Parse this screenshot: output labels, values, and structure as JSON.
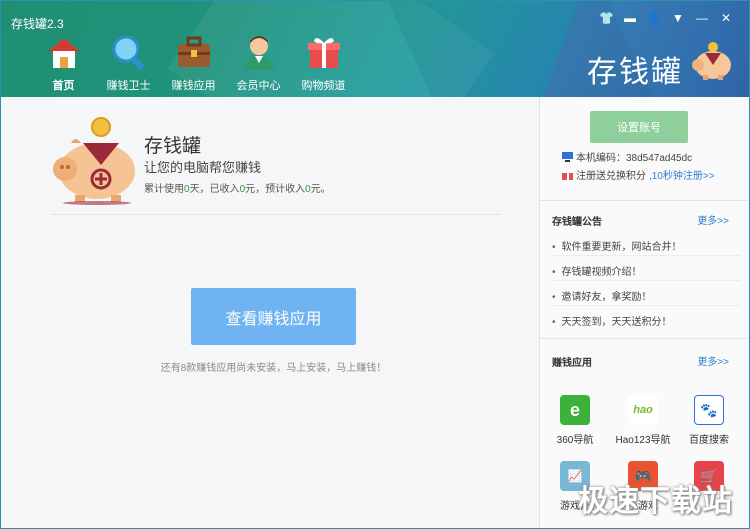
{
  "app": {
    "title": "存钱罐2.3",
    "brand": "存钱罐"
  },
  "window_controls": {
    "skin": "👕",
    "msg": "▬",
    "user": "👤",
    "menu": "▼",
    "minimize": "—",
    "close": "✕"
  },
  "nav": [
    {
      "label": "首页",
      "icon": "house-icon"
    },
    {
      "label": "赚钱卫士",
      "icon": "magnifier-icon"
    },
    {
      "label": "赚钱应用",
      "icon": "briefcase-icon"
    },
    {
      "label": "会员中心",
      "icon": "person-icon"
    },
    {
      "label": "购物频道",
      "icon": "giftbox-icon"
    }
  ],
  "hero": {
    "title": "存钱罐",
    "subtitle": "让您的电脑帮您赚钱",
    "stat_a": "累计使用",
    "days": "0",
    "stat_b": "天，已收入",
    "income": "0",
    "stat_c": "元，预计收入",
    "expected": "0",
    "stat_d": "元。"
  },
  "cta": {
    "label": "查看赚钱应用"
  },
  "note": "还有8款赚钱应用尚未安装，马上安装，马上赚钱！",
  "side": {
    "account_button": "设置账号",
    "machine_label": "本机编码：38d547ad45dc",
    "gift_text": "注册送兑换积分",
    "gift_link": ",10秒钟注册>>",
    "notice_title": "存钱罐公告",
    "more": "更多>>",
    "notices": [
      "软件重要更新，网站合并！",
      "存钱罐视频介绍！",
      "邀请好友，拿奖励！",
      "天天签到，天天送积分！"
    ],
    "apps_title": "赚钱应用",
    "apps": [
      {
        "label": "360导航",
        "icon": "e-browser-icon",
        "color": "#3cb23c"
      },
      {
        "label": "Hao123导航",
        "icon": "hao123-icon",
        "color": "#ffffff"
      },
      {
        "label": "百度搜索",
        "icon": "baidu-paw-icon",
        "color": "#2f6fd8"
      },
      {
        "label": "游戏开",
        "icon": "game-chart-icon",
        "color": "#78b7d6"
      },
      {
        "label": "小游戏",
        "icon": "gamepad-icon",
        "color": "#e9532f"
      },
      {
        "label": "",
        "icon": "shopping-cart-icon",
        "color": "#e8424a"
      }
    ]
  },
  "watermark": "极速下载站"
}
